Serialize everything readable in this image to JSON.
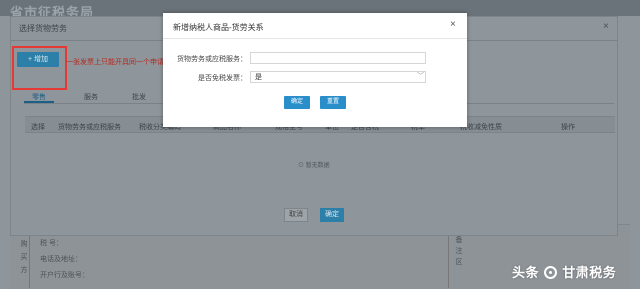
{
  "background": {
    "page_title": "省市征税务局",
    "form_fields": [
      "税 号：",
      "电话及地址：",
      "开户行及账号："
    ],
    "vertical_label_left": "购买方",
    "vertical_label_right": "备注区"
  },
  "outer_dialog": {
    "title": "选择货物劳务",
    "close": "×",
    "add_button": "+ 增加",
    "note": "一张发票上只能开具同一个申请",
    "tabs": [
      "零售",
      "服务",
      "批发"
    ],
    "columns": [
      "选择",
      "货物劳务或应税服务",
      "税收分类编码",
      "商品名称",
      "规格型号",
      "单位",
      "是否含税",
      "税率",
      "税收减免性质",
      "操作"
    ],
    "empty_text": "暂无数据",
    "cancel_button": "取消",
    "confirm_button": "确定"
  },
  "modal": {
    "title": "新增纳税人商品-货劳关系",
    "close": "×",
    "goods_label": "货物劳务或应税服务：",
    "goods_value": "",
    "exempt_label": "是否免税发票：",
    "exempt_value": "是",
    "confirm_button": "确定",
    "reset_button": "重置"
  },
  "watermark": {
    "prefix": "头条",
    "suffix": "甘肃税务"
  },
  "colors": {
    "accent": "#2a8ecb",
    "highlight_box": "#e53935"
  }
}
